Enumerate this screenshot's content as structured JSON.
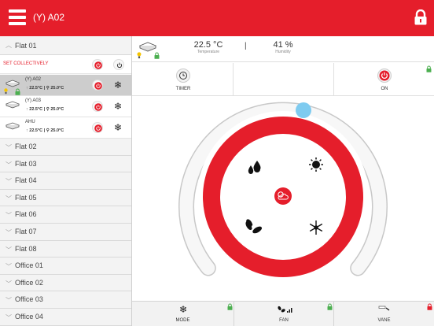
{
  "header": {
    "title": "(Y) A02"
  },
  "sidebar": {
    "expanded_group": "Flat 01",
    "set_collectively_label": "SET COLLECTIVELY",
    "units": [
      {
        "name": "(Y) A02",
        "temp": "22.5°C",
        "setpoint": "25.0°C",
        "selected": true
      },
      {
        "name": "(Y) A03",
        "temp": "22.5°C",
        "setpoint": "25.0°C",
        "selected": false
      },
      {
        "name": "AHU",
        "temp": "22.5°C",
        "setpoint": "25.0°C",
        "selected": false
      }
    ],
    "groups": [
      "Flat 02",
      "Flat 03",
      "Flat 04",
      "Flat 05",
      "Flat 06",
      "Flat 07",
      "Flat 08",
      "Office 01",
      "Office 02",
      "Office 03",
      "Office 04"
    ]
  },
  "status": {
    "temperature_value": "22.5 °C",
    "temperature_caption": "Temperature",
    "separator": "|",
    "humidity_value": "41 %",
    "humidity_caption": "Humidity"
  },
  "controls": {
    "timer_label": "TIMER",
    "on_label": "ON"
  },
  "bottom": {
    "mode_label": "MODE",
    "fan_label": "FAN",
    "vane_label": "VANE"
  },
  "colors": {
    "brand_red": "#e51e2b",
    "lock_green": "#4caf50",
    "slider_blue": "#7ecbf0"
  }
}
